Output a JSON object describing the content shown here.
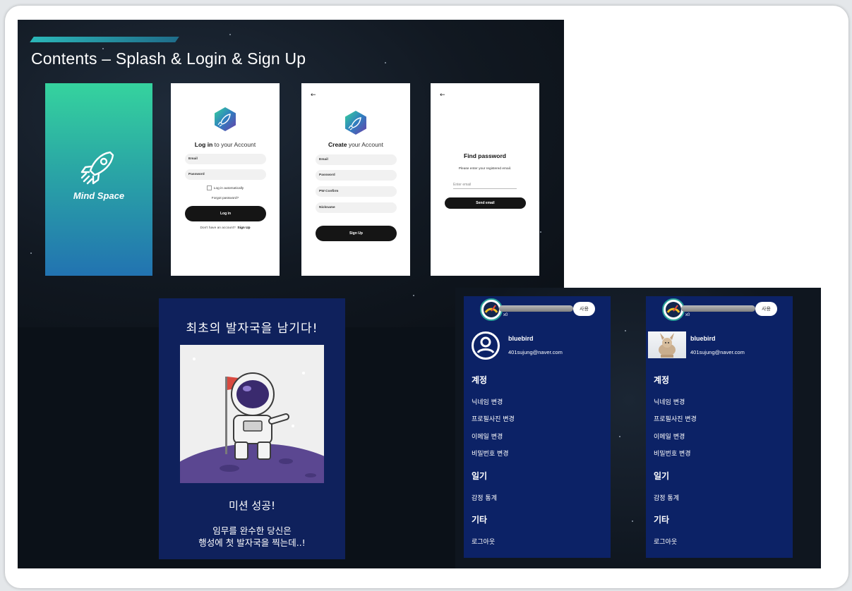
{
  "slide": {
    "title": "Contents – Splash & Login & Sign Up"
  },
  "splash": {
    "brand": "Mind Space",
    "colors": {
      "top": "#35d39e",
      "bottom": "#2273b1"
    }
  },
  "login": {
    "title_bold": "Log in",
    "title_rest": " to your Account",
    "email_label": "Email",
    "password_label": "Password",
    "auto_login": "Log in automatically",
    "forgot": "Forgot password?",
    "button": "Log in",
    "no_account": "Don't have an account?",
    "signup_link": "Sign Up"
  },
  "signup": {
    "title_bold": "Create",
    "title_rest": " your Account",
    "email_label": "Email",
    "password_label": "Password",
    "pw_confirm_label": "PW Confirm",
    "nickname_label": "Nickname",
    "button": "Sign Up"
  },
  "find_password": {
    "title": "Find password",
    "instruction": "Please enter your registered email.",
    "email_placeholder": "Enter email",
    "button": "Send email"
  },
  "poster": {
    "title": "최초의 발자국을 남기다!",
    "subtitle": "미션 성공!",
    "body_line1": "임무를 완수한 당신은",
    "body_line2": "행성에 첫 발자국을 찍는데..!",
    "bg_color": "#0f215c"
  },
  "profile_screens": [
    {
      "count": "x0",
      "use_button": "사용",
      "username": "bluebird",
      "email": "401sujung@naver.com",
      "avatar": "user-circle-icon",
      "sections": {
        "account": "계정",
        "change_nickname": "닉네임 변경",
        "change_photo": "프로필사진 변경",
        "change_email": "이메일 변경",
        "change_password": "비밀번호 변경",
        "diary": "일기",
        "emotion_stats": "감정 통계",
        "etc": "기타",
        "logout": "로그아웃"
      }
    },
    {
      "count": "x0",
      "use_button": "사용",
      "username": "bluebird",
      "email": "401sujung@naver.com",
      "avatar": "profile-photo",
      "sections": {
        "account": "계정",
        "change_nickname": "닉네임 변경",
        "change_photo": "프로필사진 변경",
        "change_email": "이메일 변경",
        "change_password": "비밀번호 변경",
        "diary": "일기",
        "emotion_stats": "감정 통계",
        "etc": "기타",
        "logout": "로그아웃"
      }
    }
  ],
  "colors": {
    "phone_bg": "#0c2266",
    "accent": "#2bb6b8",
    "button_dark": "#151515"
  }
}
